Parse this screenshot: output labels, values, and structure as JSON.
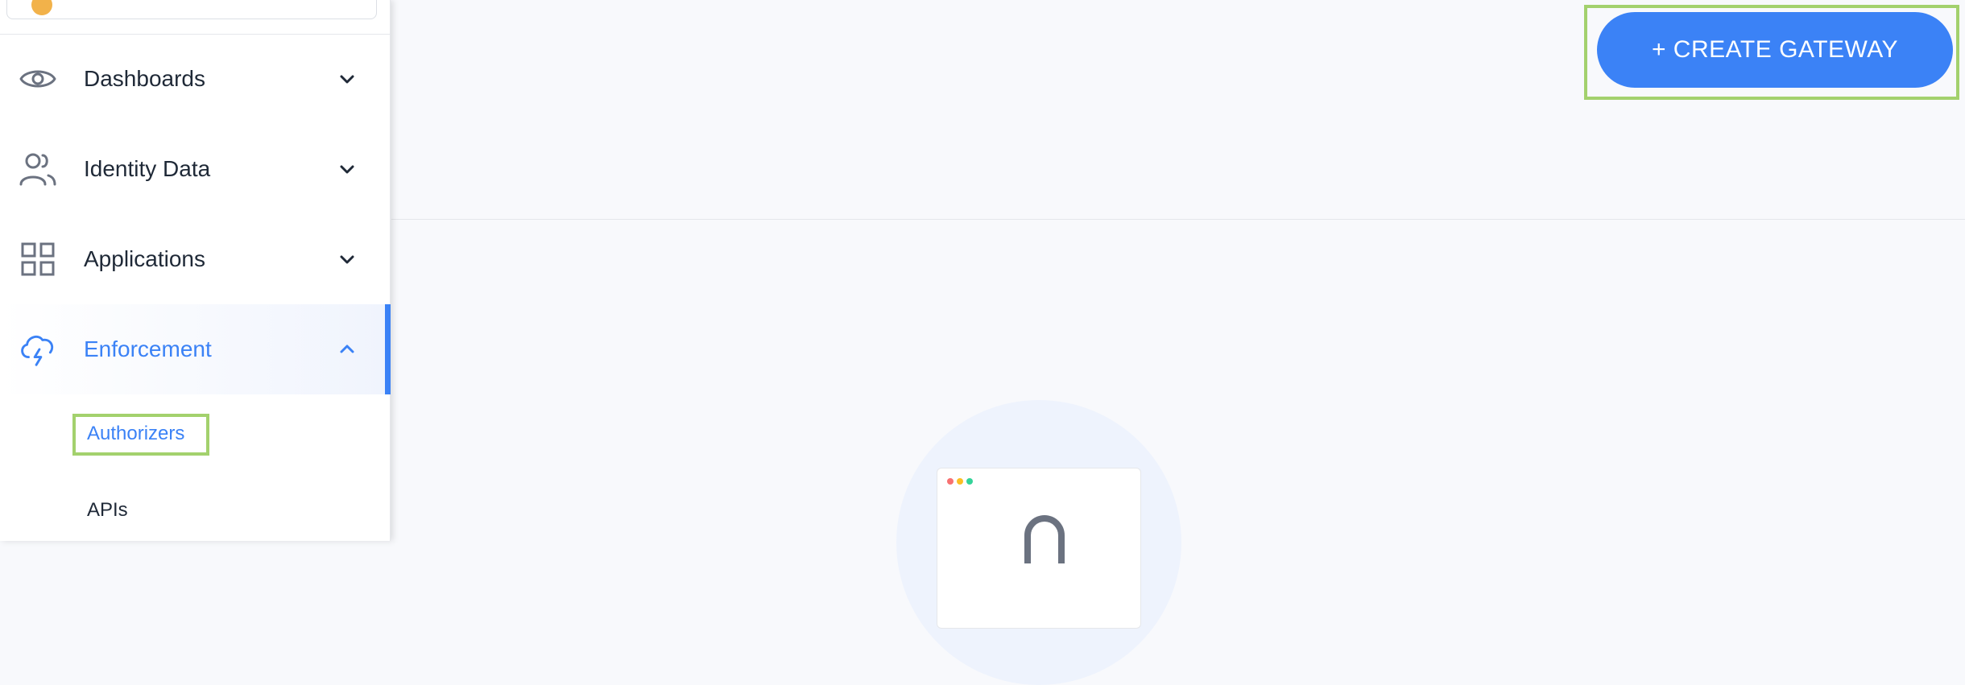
{
  "sidebar": {
    "items": [
      {
        "label": "Dashboards",
        "icon": "eye-icon",
        "expanded": false
      },
      {
        "label": "Identity Data",
        "icon": "users-icon",
        "expanded": false
      },
      {
        "label": "Applications",
        "icon": "grid-icon",
        "expanded": false
      },
      {
        "label": "Enforcement",
        "icon": "cloud-lightning-icon",
        "expanded": true
      }
    ],
    "sub_items": [
      {
        "label": "Authorizers",
        "selected": true
      },
      {
        "label": "APIs",
        "selected": false
      }
    ]
  },
  "main": {
    "create_button_label": "+ CREATE GATEWAY"
  },
  "colors": {
    "accent": "#3b82f6",
    "highlight": "#a3d16d",
    "text": "#1f2937"
  }
}
